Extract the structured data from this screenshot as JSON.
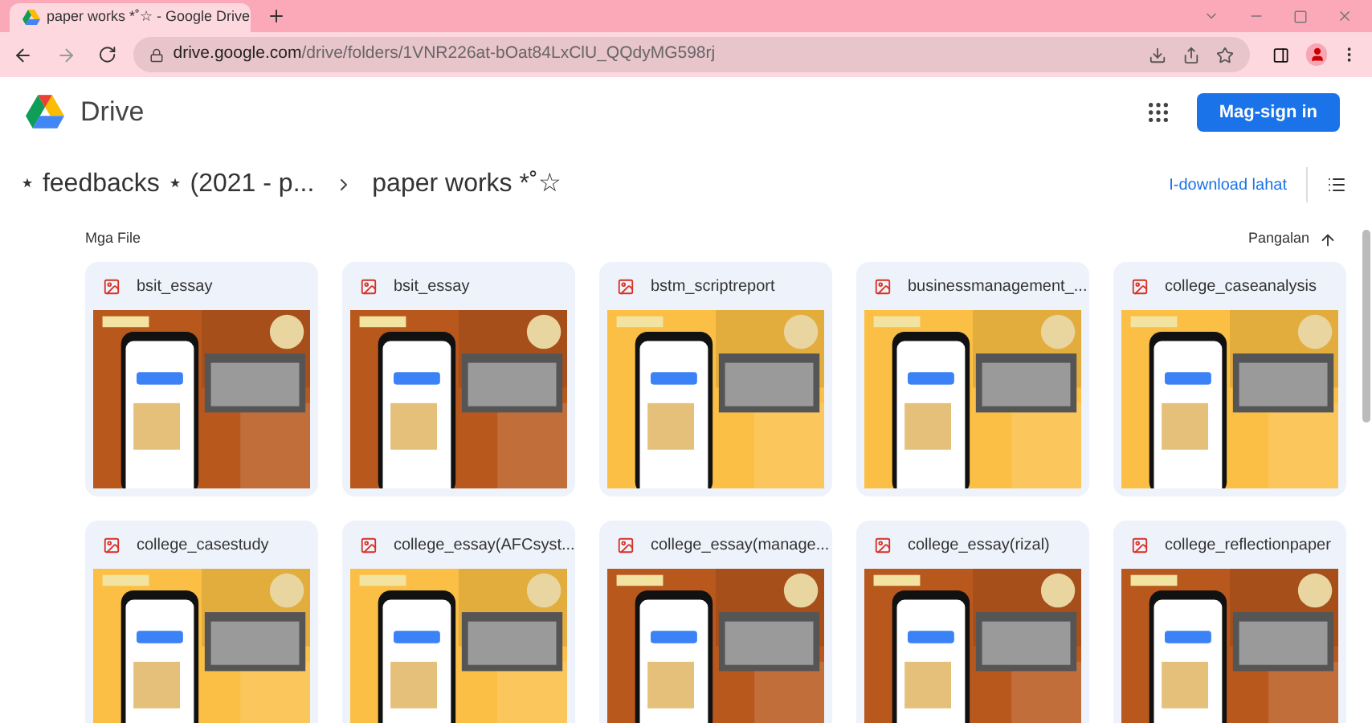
{
  "browser": {
    "tab_title": "paper works *˚☆ - Google Drive",
    "url_host": "drive.google.com",
    "url_path": "/drive/folders/1VNR226at-bOat84LxClU_QQdyMG598rj"
  },
  "header": {
    "app_name": "Drive",
    "sign_in": "Mag-sign in"
  },
  "breadcrumb": [
    {
      "label": "⋆ feedbacks ⋆ (2021 - p..."
    },
    {
      "label": "paper works *˚☆"
    }
  ],
  "download": "I-download lahat",
  "section_title": "Mga File",
  "sort": {
    "label": "Pangalan"
  },
  "files": [
    {
      "name": "bsit_essay",
      "color": "#b9581d"
    },
    {
      "name": "bsit_essay",
      "color": "#b9581d"
    },
    {
      "name": "bstm_scriptreport",
      "color": "#fbbf45"
    },
    {
      "name": "businessmanagement_...",
      "color": "#fbbf45"
    },
    {
      "name": "college_caseanalysis",
      "color": "#fbbf45"
    },
    {
      "name": "college_casestudy",
      "color": "#fbbf45"
    },
    {
      "name": "college_essay(AFCsyst...",
      "color": "#fbbf45"
    },
    {
      "name": "college_essay(manage...",
      "color": "#b9581d"
    },
    {
      "name": "college_essay(rizal)",
      "color": "#b9581d"
    },
    {
      "name": "college_reflectionpaper",
      "color": "#b9581d"
    }
  ]
}
